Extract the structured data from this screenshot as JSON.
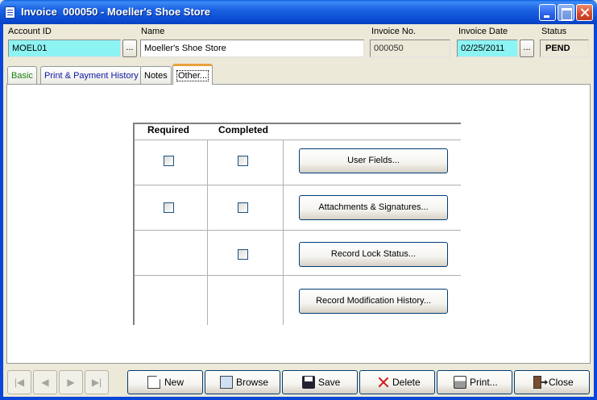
{
  "window": {
    "title": "Invoice  000050 - Moeller's Shoe Store"
  },
  "header": {
    "account_id_label": "Account ID",
    "account_id_value": "MOEL01",
    "name_label": "Name",
    "name_value": "Moeller's Shoe Store",
    "invoice_no_label": "Invoice No.",
    "invoice_no_value": "000050",
    "invoice_date_label": "Invoice Date",
    "invoice_date_value": "02/25/2011",
    "status_label": "Status",
    "status_value": "PEND",
    "lookup_button_label": "..."
  },
  "tabs": [
    {
      "label": "Basic",
      "active": false
    },
    {
      "label": "Print & Payment History",
      "active": false
    },
    {
      "label": "Notes",
      "active": false
    },
    {
      "label": "Other...",
      "active": true
    }
  ],
  "other": {
    "required_header": "Required",
    "completed_header": "Completed",
    "rows": [
      {
        "button_label": "User Fields...",
        "required_checkbox": true,
        "required_checked": false,
        "completed_checkbox": true,
        "completed_checked": false
      },
      {
        "button_label": "Attachments & Signatures...",
        "required_checkbox": true,
        "required_checked": false,
        "completed_checkbox": true,
        "completed_checked": false
      },
      {
        "button_label": "Record Lock Status...",
        "required_checkbox": false,
        "completed_checkbox": true,
        "completed_checked": false
      },
      {
        "button_label": "Record Modification History...",
        "required_checkbox": false,
        "completed_checkbox": false
      }
    ]
  },
  "toolbar": {
    "nav_first_icon": "first-record-icon",
    "nav_prev_icon": "previous-record-icon",
    "nav_next_icon": "next-record-icon",
    "nav_last_icon": "last-record-icon",
    "new_label": "New",
    "browse_label": "Browse",
    "save_label": "Save",
    "delete_label": "Delete",
    "print_label": "Print...",
    "close_label": "Close"
  },
  "colors": {
    "title_bar": "#1a62e3",
    "key_field_bg": "#8df4f4",
    "active_tab_accent": "#e8a23c"
  }
}
